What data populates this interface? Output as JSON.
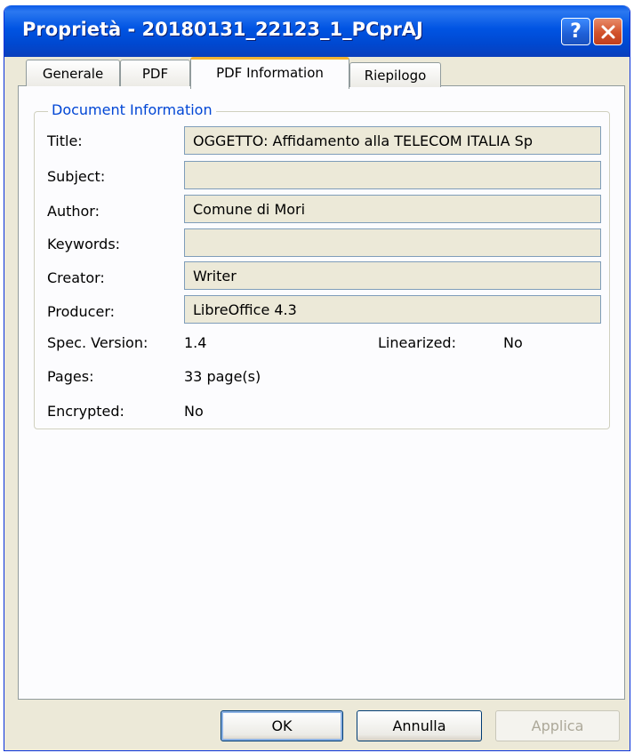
{
  "window": {
    "title": "Proprietà - 20180131_22123_1_PCprAJ",
    "help_glyph": "?"
  },
  "tabs": [
    {
      "label": "Generale"
    },
    {
      "label": "PDF"
    },
    {
      "label": "PDF Information",
      "active": true
    },
    {
      "label": "Riepilogo"
    }
  ],
  "group": {
    "legend": "Document Information"
  },
  "fields": {
    "title": {
      "label": "Title:",
      "value": "OGGETTO: Affidamento alla TELECOM ITALIA Sp"
    },
    "subject": {
      "label": "Subject:",
      "value": ""
    },
    "author": {
      "label": "Author:",
      "value": "Comune di Mori"
    },
    "keywords": {
      "label": "Keywords:",
      "value": ""
    },
    "creator": {
      "label": "Creator:",
      "value": "Writer"
    },
    "producer": {
      "label": "Producer:",
      "value": "LibreOffice 4.3"
    }
  },
  "info": {
    "spec_version_label": "Spec. Version:",
    "spec_version_value": "1.4",
    "linearized_label": "Linearized:",
    "linearized_value": "No",
    "pages_label": "Pages:",
    "pages_value": "33 page(s)",
    "encrypted_label": "Encrypted:",
    "encrypted_value": "No"
  },
  "buttons": {
    "ok": "OK",
    "cancel": "Annulla",
    "apply": "Applica"
  },
  "colors": {
    "titlebar": "#0054e3",
    "legend": "#0046d5",
    "active_tab_accent": "#f5b533",
    "dialog_bg": "#ece9d8"
  },
  "icons": {
    "help": "help-icon",
    "close": "close-icon"
  }
}
